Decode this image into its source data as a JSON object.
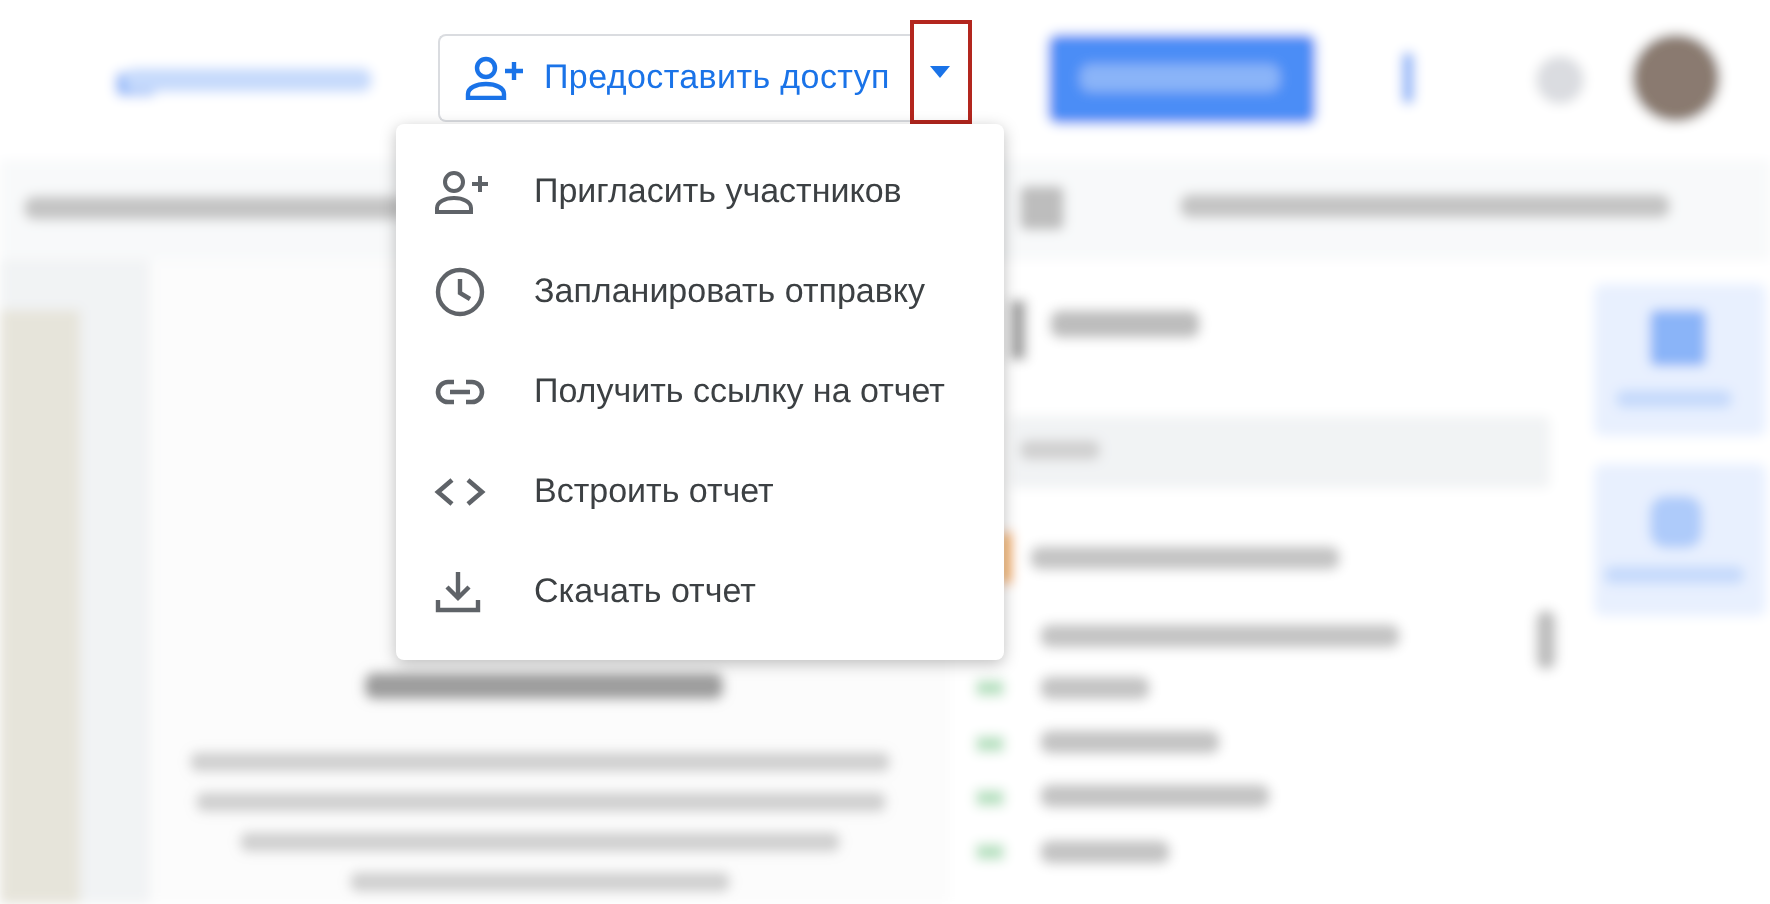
{
  "background": {
    "blurred": true
  },
  "share_button": {
    "label": "Предоставить доступ"
  },
  "dropdown_button": {
    "highlighted": true
  },
  "menu": {
    "items": [
      {
        "kind": "invite",
        "label": "Пригласить участников"
      },
      {
        "kind": "schedule",
        "label": "Запланировать отправку"
      },
      {
        "kind": "link",
        "label": "Получить ссылку на отчет"
      },
      {
        "kind": "embed",
        "label": "Встроить отчет"
      },
      {
        "kind": "download",
        "label": "Скачать отчет"
      }
    ]
  }
}
